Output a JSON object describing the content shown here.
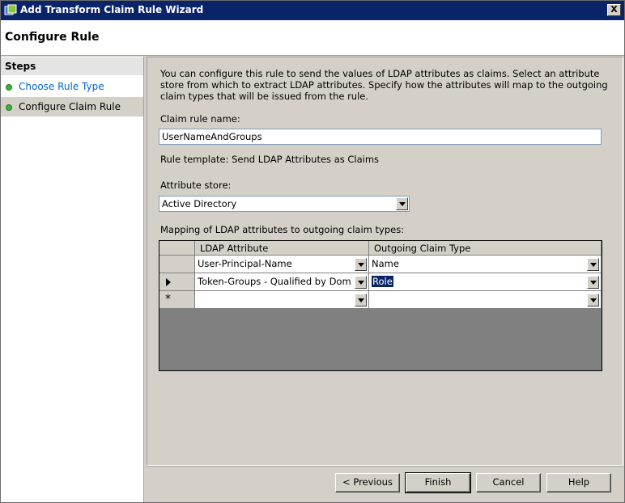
{
  "window": {
    "title": "Add Transform Claim Rule Wizard",
    "close_label": "X"
  },
  "header": {
    "title": "Configure Rule"
  },
  "steps": {
    "title": "Steps",
    "items": [
      {
        "label": "Choose Rule Type"
      },
      {
        "label": "Configure Claim Rule"
      }
    ]
  },
  "main": {
    "intro": "You can configure this rule to send the values of LDAP attributes as claims. Select an attribute store from which to extract LDAP attributes. Specify how the attributes will map to the outgoing claim types that will be issued from the rule.",
    "claim_rule_name_label": "Claim rule name:",
    "claim_rule_name_value": "UserNameAndGroups",
    "rule_template": "Rule template: Send LDAP Attributes as Claims",
    "attribute_store_label": "Attribute store:",
    "attribute_store_value": "Active Directory",
    "mapping_label": "Mapping of LDAP attributes to outgoing claim types:",
    "grid": {
      "columns": [
        "LDAP Attribute",
        "Outgoing Claim Type"
      ],
      "rows": [
        {
          "ldap": "User-Principal-Name",
          "claim": "Name"
        },
        {
          "ldap": "Token-Groups - Qualified by Doma...",
          "claim": "Role"
        },
        {
          "ldap": "",
          "claim": ""
        }
      ],
      "new_row_marker": "*"
    }
  },
  "footer": {
    "previous": "< Previous",
    "finish": "Finish",
    "cancel": "Cancel",
    "help": "Help"
  }
}
